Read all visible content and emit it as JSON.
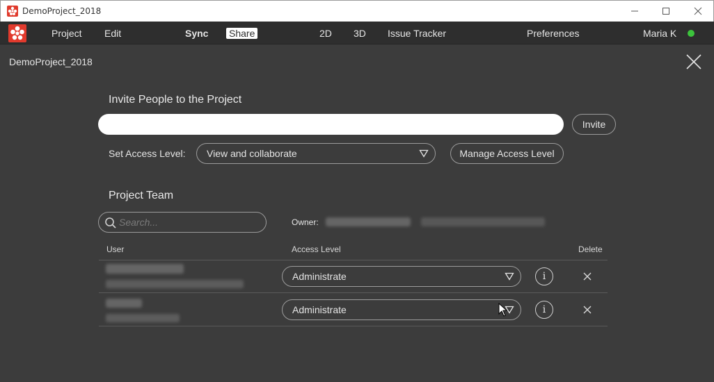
{
  "window": {
    "title": "DemoProject_2018"
  },
  "menu": {
    "items": [
      "Project",
      "Edit",
      "Sync",
      "Share",
      "2D",
      "3D",
      "Issue Tracker",
      "Preferences"
    ],
    "user": "Maria K",
    "status_color": "#3cc33c"
  },
  "panel": {
    "project_name": "DemoProject_2018",
    "invite_title": "Invite People to the Project",
    "invite_value": "",
    "invite_button": "Invite",
    "access_label": "Set Access Level:",
    "access_value": "View and collaborate",
    "manage_button": "Manage Access Level",
    "team_title": "Project Team",
    "search_placeholder": "Search...",
    "owner_label": "Owner:",
    "columns": {
      "user": "User",
      "access": "Access Level",
      "delete": "Delete"
    },
    "rows": [
      {
        "access": "Administrate"
      },
      {
        "access": "Administrate"
      }
    ]
  },
  "colors": {
    "brand": "#e23a2d",
    "background": "#3c3c3c",
    "menubar": "#2e2e2e"
  },
  "icons": [
    "app-logo-icon",
    "minimize-icon",
    "maximize-icon",
    "close-icon",
    "search-icon",
    "dropdown-caret-icon",
    "info-icon",
    "delete-x-icon",
    "mouse-cursor-icon"
  ]
}
